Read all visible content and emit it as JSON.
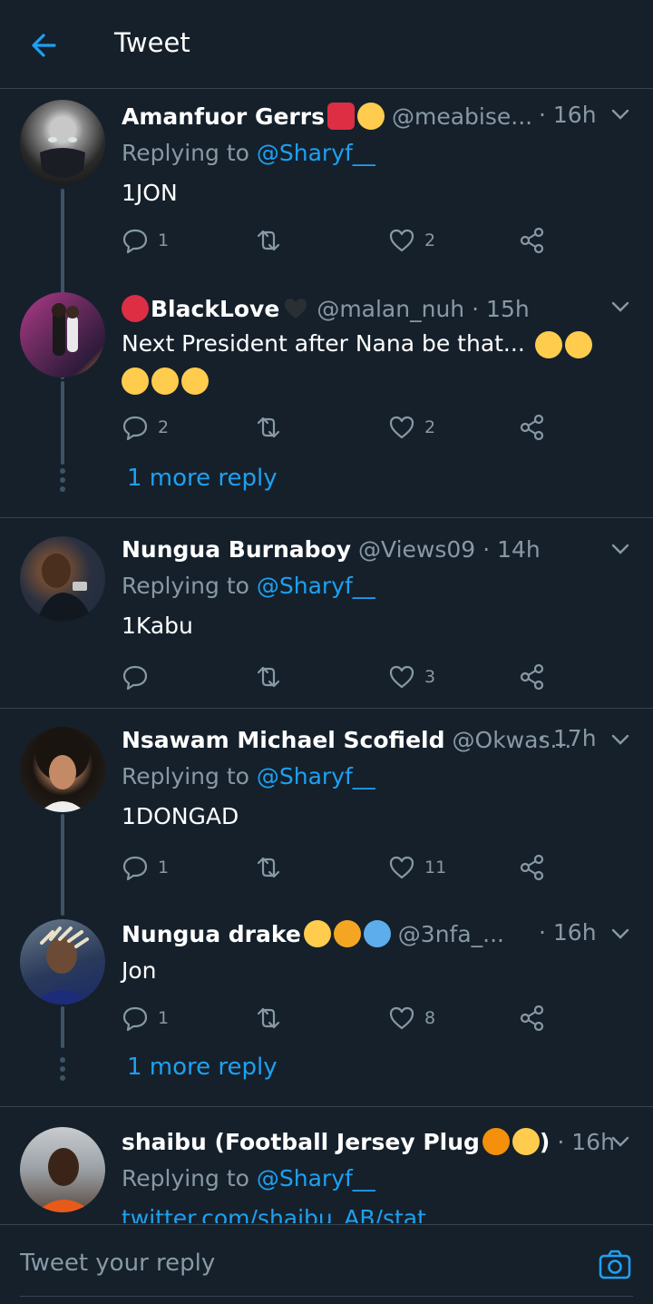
{
  "header": {
    "title": "Tweet"
  },
  "tweets": [
    {
      "name": "Amanfuor Gerrs",
      "handle": "@meabise...",
      "time": "· 16h",
      "replying_prefix": "Replying to ",
      "replying_to": "@Sharyf__",
      "text": "1JON",
      "replies": "1",
      "retweets": "",
      "likes": "2"
    },
    {
      "name": "BlackLove",
      "handle": "@malan_nuh",
      "time": "· 15h",
      "text": "Next President after Nana be that...",
      "replies": "2",
      "retweets": "",
      "likes": "2",
      "more_replies": "1 more reply"
    },
    {
      "name": "Nungua Burnaboy",
      "handle": "@Views09",
      "time": "· 14h",
      "replying_prefix": "Replying to ",
      "replying_to": "@Sharyf__",
      "text": "1Kabu",
      "replies": "",
      "retweets": "",
      "likes": "3"
    },
    {
      "name": "Nsawam Michael Scofield",
      "handle": "@Okwas...",
      "time": "· 17h",
      "replying_prefix": "Replying to ",
      "replying_to": "@Sharyf__",
      "text": "1DONGAD",
      "replies": "1",
      "retweets": "",
      "likes": "11"
    },
    {
      "name": "Nungua drake",
      "handle": "@3nfa_...",
      "time": "· 16h",
      "text": "Jon",
      "replies": "1",
      "retweets": "",
      "likes": "8",
      "more_replies": "1 more reply"
    },
    {
      "name": "shaibu (Football Jersey Plug",
      "name_suffix": ")",
      "handle": "",
      "time": "· 16h",
      "replying_prefix": "Replying to ",
      "replying_to": "@Sharyf__",
      "link": "twitter.com/shaibu_AB/stat"
    }
  ],
  "reply_bar": {
    "placeholder": "Tweet your reply"
  },
  "colors": {
    "background": "#15202b",
    "accent": "#1da1f2",
    "secondary_text": "#8899a6",
    "divider": "#38444d"
  },
  "icons": [
    "back-arrow-icon",
    "chevron-down-icon",
    "reply-icon",
    "retweet-icon",
    "like-icon",
    "share-icon",
    "camera-icon"
  ]
}
